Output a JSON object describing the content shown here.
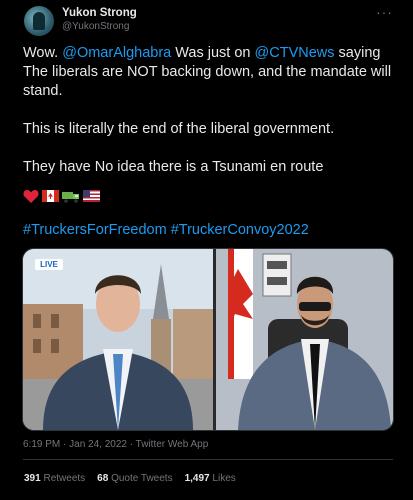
{
  "tweet": {
    "display_name": "Yukon Strong",
    "handle": "@YukonStrong",
    "more_label": "···",
    "text": {
      "p1_a": "Wow. ",
      "p1_mention1": "@OmarAlghabra",
      "p1_b": " Was just on ",
      "p1_mention2": "@CTVNews",
      "p1_c": " saying The liberals are NOT backing down, and the mandate will stand.",
      "p2": "This is literally the end of the liberal government.",
      "p3": "They have No idea there is a Tsunami en route"
    },
    "emojis": [
      "red-heart",
      "canada-flag",
      "truck",
      "us-flag"
    ],
    "hashtags": "#TruckersForFreedom #TruckerConvoy2022",
    "media": {
      "live_badge": "LIVE"
    },
    "timestamp": "6:19 PM · Jan 24, 2022 · Twitter Web App",
    "stats": {
      "retweets_count": "391",
      "retweets_label": "Retweets",
      "quotes_count": "68",
      "quotes_label": "Quote Tweets",
      "likes_count": "1,497",
      "likes_label": "Likes"
    }
  },
  "colors": {
    "background": "#000000",
    "text": "#e7e9ea",
    "secondary": "#71767b",
    "link": "#1d9bf0",
    "divider": "#2f3336"
  }
}
